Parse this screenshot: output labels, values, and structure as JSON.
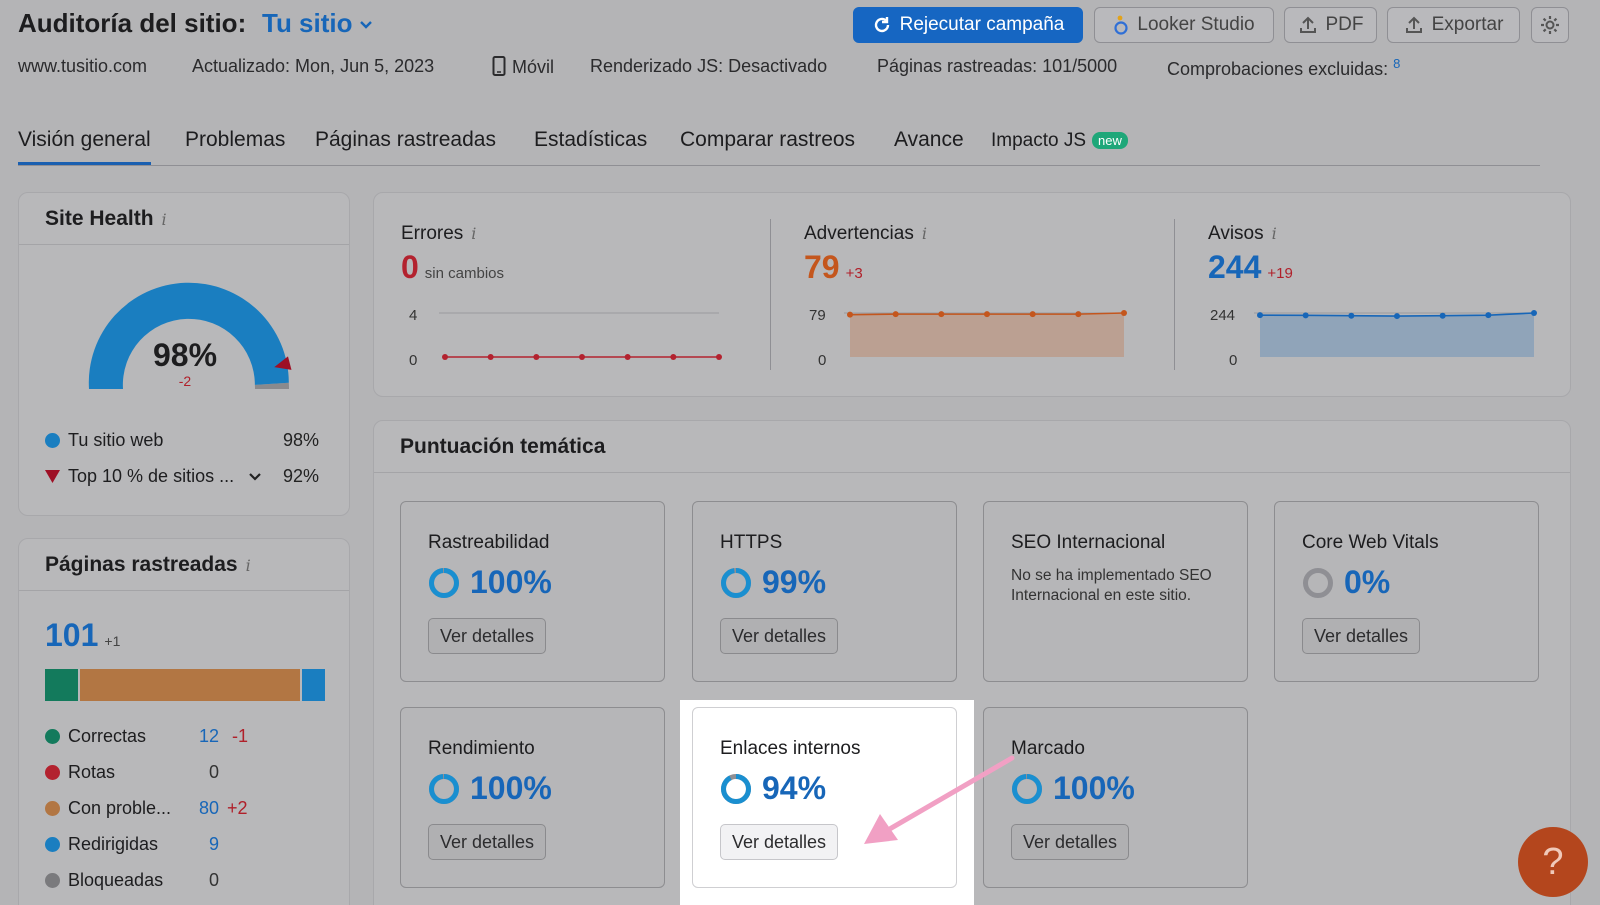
{
  "header": {
    "title": "Auditoría del sitio:",
    "site_selector": "Tu sitio",
    "buttons": {
      "recrawl": "Rejecutar campaña",
      "looker": "Looker Studio",
      "pdf": "PDF",
      "export": "Exportar"
    },
    "meta": {
      "domain": "www.tusitio.com",
      "updated": "Actualizado: Mon, Jun 5, 2023",
      "device": "Móvil",
      "js_render": "Renderizado JS: Desactivado",
      "pages_crawled": "Páginas rastreadas: 101/5000",
      "excluded_label": "Comprobaciones excluidas:",
      "excluded_count": "8"
    }
  },
  "tabs": [
    {
      "label": "Visión general"
    },
    {
      "label": "Problemas"
    },
    {
      "label": "Páginas rastreadas"
    },
    {
      "label": "Estadísticas"
    },
    {
      "label": "Comparar rastreos"
    },
    {
      "label": "Avance"
    },
    {
      "label": "Impacto JS",
      "badge": "new"
    }
  ],
  "site_health": {
    "title": "Site Health",
    "score": "98%",
    "score_value": 0.98,
    "top10_value": 0.92,
    "delta": "-2",
    "legend": [
      {
        "label": "Tu sitio web",
        "value": "98%",
        "color": "#1a7ec0"
      },
      {
        "label": "Top 10 % de sitios ...",
        "value": "92%",
        "color": "#9e0f25"
      }
    ]
  },
  "crawled_pages": {
    "title": "Páginas rastreadas",
    "total": "101",
    "delta": "+1",
    "bar": [
      {
        "key": "correct",
        "value": 12,
        "color": "#137a5c"
      },
      {
        "key": "issues",
        "value": 80,
        "color": "#b27643"
      },
      {
        "key": "redirected",
        "value": 9,
        "color": "#1a7ec0"
      }
    ],
    "rows": [
      {
        "label": "Correctas",
        "value": "12",
        "delta": "-1",
        "color": "#137a5c"
      },
      {
        "label": "Rotas",
        "value": "0",
        "delta": "",
        "color": "#b3222f"
      },
      {
        "label": "Con proble...",
        "value": "80",
        "delta": "+2",
        "color": "#b27643"
      },
      {
        "label": "Redirigidas",
        "value": "9",
        "delta": "",
        "color": "#1a7ec0"
      },
      {
        "label": "Bloqueadas",
        "value": "0",
        "delta": "",
        "color": "#7a7a7d"
      }
    ]
  },
  "metrics": [
    {
      "label": "Errores",
      "value": "0",
      "delta": "sin cambios",
      "ymax": "4",
      "ymin": "0",
      "color": "#b3222f",
      "points": [
        0,
        0,
        0,
        0,
        0,
        0,
        0
      ]
    },
    {
      "label": "Advertencias",
      "value": "79",
      "delta": "+3",
      "ymax": "79",
      "ymin": "0",
      "color": "#c4561d",
      "points": [
        76,
        77,
        77,
        77,
        77,
        77,
        79
      ]
    },
    {
      "label": "Avisos",
      "value": "244",
      "delta": "+19",
      "ymax": "244",
      "ymin": "0",
      "color": "#1766b8",
      "points": [
        232,
        231,
        229,
        227,
        229,
        232,
        244
      ]
    }
  ],
  "thematic": {
    "title": "Puntuación temática",
    "tiles": [
      {
        "title": "Rastreabilidad",
        "pct": "100%",
        "value": 1.0,
        "button": "Ver detalles"
      },
      {
        "title": "HTTPS",
        "pct": "99%",
        "value": 0.99,
        "button": "Ver detalles"
      },
      {
        "title": "SEO Internacional",
        "desc": "No se ha implementado SEO Internacional en este sitio."
      },
      {
        "title": "Core Web Vitals",
        "pct": "0%",
        "value": 0.0,
        "button": "Ver detalles"
      },
      {
        "title": "Rendimiento",
        "pct": "100%",
        "value": 1.0,
        "button": "Ver detalles"
      },
      {
        "title": "Enlaces internos",
        "pct": "94%",
        "value": 0.94,
        "button": "Ver detalles"
      },
      {
        "title": "Marcado",
        "pct": "100%",
        "value": 1.0,
        "button": "Ver detalles"
      }
    ]
  },
  "help_label": "?"
}
